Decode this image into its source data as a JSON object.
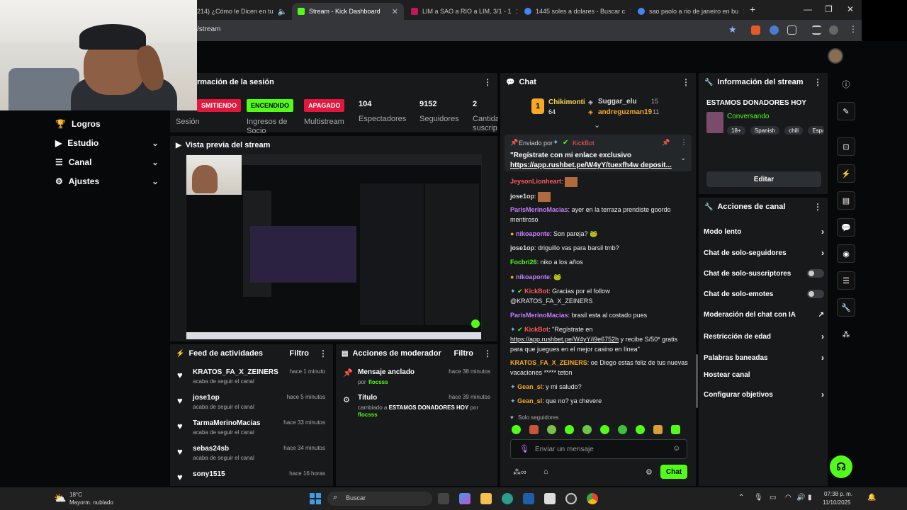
{
  "browser": {
    "tabs": [
      {
        "title": "214) ¿Cómo le Dicen en tu",
        "active": false
      },
      {
        "title": "Stream - Kick Dashboard",
        "active": true
      },
      {
        "title": "LIM a SAO a RIO a LIM, 3/1 - 1",
        "active": false
      },
      {
        "title": "1445 soles a dolares - Buscar c",
        "active": false
      },
      {
        "title": "sao paolo a rio de janeiro en bu",
        "active": false
      }
    ],
    "url": "/stream",
    "new_tab": "+"
  },
  "nav": {
    "items": [
      {
        "label": "Logros",
        "icon": "trophy-icon"
      },
      {
        "label": "Estudio",
        "icon": "video-icon"
      },
      {
        "label": "Canal",
        "icon": "list-icon"
      },
      {
        "label": "Ajustes",
        "icon": "gear-icon"
      }
    ]
  },
  "session": {
    "title": "rmación de la sesión",
    "badges": [
      {
        "label": "SMITIENDO",
        "caption": "Sesión"
      },
      {
        "label": "ENCENDIDO",
        "caption": "Ingresos de Socio"
      },
      {
        "label": "APAGADO",
        "caption": "Multistream"
      }
    ],
    "stats": [
      {
        "value": "104",
        "label": "Espectadores"
      },
      {
        "value": "9152",
        "label": "Seguidores"
      },
      {
        "value": "2",
        "label": "Cantidad suscrip"
      }
    ]
  },
  "preview": {
    "title": "Vista previa del stream"
  },
  "feed": {
    "title": "Feed de actividades",
    "filter": "Filtro",
    "items": [
      {
        "name": "KRATOS_FA_X_ZEINERS",
        "sub": "acaba de seguir el canal",
        "time": "hace 1 minuto"
      },
      {
        "name": "jose1op",
        "sub": "acaba de seguir el canal",
        "time": "hace 5 minutos"
      },
      {
        "name": "TarmaMerinoMacias",
        "sub": "acaba de seguir el canal",
        "time": "hace 33 minutos"
      },
      {
        "name": "sebas24sb",
        "sub": "acaba de seguir el canal",
        "time": "hace 34 minutos"
      },
      {
        "name": "sony1515",
        "sub": "",
        "time": "hace 16 horas"
      }
    ]
  },
  "mod": {
    "title": "Acciones de moderador",
    "filter": "Filtro",
    "items": [
      {
        "title": "Mensaje anclado",
        "prefix": "por",
        "who": "flocsss",
        "time": "hace 38 minutos"
      },
      {
        "title": "Título",
        "prefix": "cambiado a",
        "value": "ESTAMOS DONADORES HOY",
        "mid": "por",
        "who": "flocsss",
        "time": "hace 39 minutos"
      }
    ]
  },
  "chat": {
    "title": "Chat",
    "top": {
      "rank": "1",
      "name": "Chikimonti",
      "amount": "64",
      "second": "Suggar_elu",
      "second_amount": "15",
      "third": "andreguzman19",
      "third_amount": "11"
    },
    "pinned": {
      "label": "Enviado por",
      "sender": "KickBot",
      "text": "\"Regístrate con mi enlace exclusivo",
      "link": "https://app.rushbet.pe/W4yY/tuexfh4w deposit..."
    },
    "messages": [
      {
        "user": "JeysonLionheart",
        "text": ""
      },
      {
        "user": "jose1op",
        "text": ""
      },
      {
        "user": "ParisMerinoMacias",
        "text": "ayer en la terraza prendiste goordo mentiroso"
      },
      {
        "user": "nikoaponte",
        "text": "Son pareja?"
      },
      {
        "user": "jose1op",
        "text": "driguillo vas para barsil tmb?"
      },
      {
        "user": "Focbri26",
        "text": "niko a los años"
      },
      {
        "user": "nikoaponte",
        "text": ""
      },
      {
        "user": "KickBot",
        "text": "Gracias por el follow @KRATOS_FA_X_ZEINERS"
      },
      {
        "user": "ParisMerinoMacias",
        "text": "brasil esta al costado pues"
      },
      {
        "user": "KickBot",
        "text": "\"Regístrate en",
        "link": "https://app.rushbet.pe/W4yY/i9e6752h",
        "text2": "y recibe S/50* gratis para que juegues en el mejor casino en línea\""
      },
      {
        "user": "KRATOS_FA_X_ZEINERS",
        "text": "oe Diego estas feliz de tus nuevas vacaciones ***** teton"
      },
      {
        "user": "Gean_sl",
        "text": "y mi saludo?"
      },
      {
        "user": "Gean_sl",
        "text": "que no? ya chevere"
      }
    ],
    "mode": "Solo seguidores",
    "placeholder": "Enviar un mensaje",
    "send": "Chat"
  },
  "streaminfo": {
    "title": "Información del stream",
    "stream_title": "ESTAMOS DONADORES HOY",
    "category": "Conversando",
    "tags": [
      "18+",
      "Spanish",
      "chill",
      "Espa"
    ],
    "edit": "Editar"
  },
  "actions": {
    "title": "Acciones de canal",
    "items": [
      {
        "label": "Modo lento",
        "control": "chevron"
      },
      {
        "label": "Chat de solo-seguidores",
        "control": "chevron"
      },
      {
        "label": "Chat de solo-suscriptores",
        "control": "toggle"
      },
      {
        "label": "Chat de solo-emotes",
        "control": "toggle"
      },
      {
        "label": "Moderación del chat con IA",
        "control": "external"
      },
      {
        "label": "Restricción de edad",
        "control": "chevron"
      },
      {
        "label": "Palabras baneadas",
        "control": "chevron"
      },
      {
        "label": "Hostear canal",
        "control": "none"
      },
      {
        "label": "Configurar objetivos",
        "control": "chevron"
      }
    ]
  },
  "taskbar": {
    "weather_temp": "18°C",
    "weather_desc": "Mayorm. nublado",
    "search": "Buscar",
    "time": "07:38 p. m.",
    "date": "11/10/2025"
  },
  "colors": {
    "accent": "#53fc18",
    "badge_red": "#e3173e",
    "panel": "#17191b",
    "background": "#070809"
  }
}
